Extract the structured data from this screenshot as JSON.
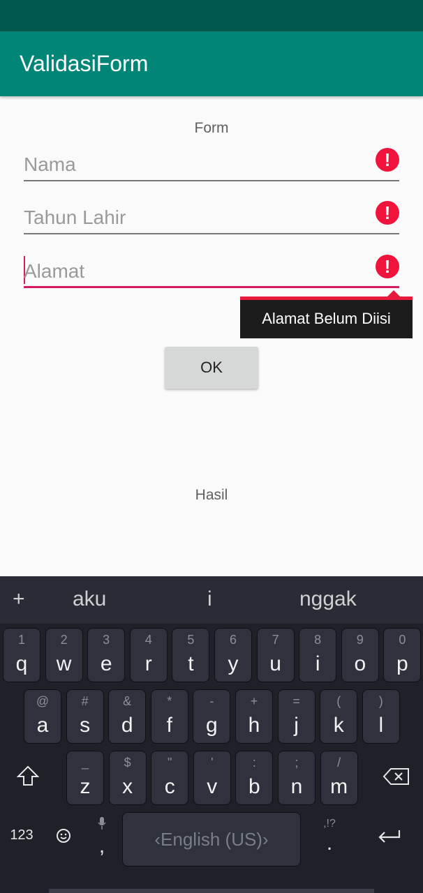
{
  "app": {
    "title": "ValidasiForm"
  },
  "form": {
    "heading": "Form",
    "fields": [
      {
        "placeholder": "Nama",
        "error_icon": "exclamation-icon"
      },
      {
        "placeholder": "Tahun Lahir",
        "error_icon": "exclamation-icon"
      },
      {
        "placeholder": "Alamat",
        "error_icon": "exclamation-icon"
      }
    ],
    "error_tooltip": "Alamat Belum Diisi",
    "ok_label": "OK",
    "result_label": "Hasil"
  },
  "keyboard": {
    "suggestions": [
      "aku",
      "i",
      "nggak"
    ],
    "row1": [
      {
        "hint": "1",
        "key": "q"
      },
      {
        "hint": "2",
        "key": "w"
      },
      {
        "hint": "3",
        "key": "e"
      },
      {
        "hint": "4",
        "key": "r"
      },
      {
        "hint": "5",
        "key": "t"
      },
      {
        "hint": "6",
        "key": "y"
      },
      {
        "hint": "7",
        "key": "u"
      },
      {
        "hint": "8",
        "key": "i"
      },
      {
        "hint": "9",
        "key": "o"
      },
      {
        "hint": "0",
        "key": "p"
      }
    ],
    "row2": [
      {
        "hint": "@",
        "key": "a"
      },
      {
        "hint": "#",
        "key": "s"
      },
      {
        "hint": "&",
        "key": "d"
      },
      {
        "hint": "*",
        "key": "f"
      },
      {
        "hint": "-",
        "key": "g"
      },
      {
        "hint": "+",
        "key": "h"
      },
      {
        "hint": "=",
        "key": "j"
      },
      {
        "hint": "(",
        "key": "k"
      },
      {
        "hint": ")",
        "key": "l"
      }
    ],
    "row3": [
      {
        "hint": "_",
        "key": "z"
      },
      {
        "hint": "$",
        "key": "x"
      },
      {
        "hint": "\"",
        "key": "c"
      },
      {
        "hint": "'",
        "key": "v"
      },
      {
        "hint": ":",
        "key": "b"
      },
      {
        "hint": ";",
        "key": "n"
      },
      {
        "hint": "/",
        "key": "m"
      }
    ],
    "num_label": "123",
    "space_label": "‹English (US)›",
    "comma_label": ",",
    "period_label": ".",
    "punct_hint": ",!?"
  },
  "colors": {
    "primary": "#008577",
    "primary_dark": "#00574b",
    "accent": "#d81b60",
    "error": "#f0143c"
  }
}
